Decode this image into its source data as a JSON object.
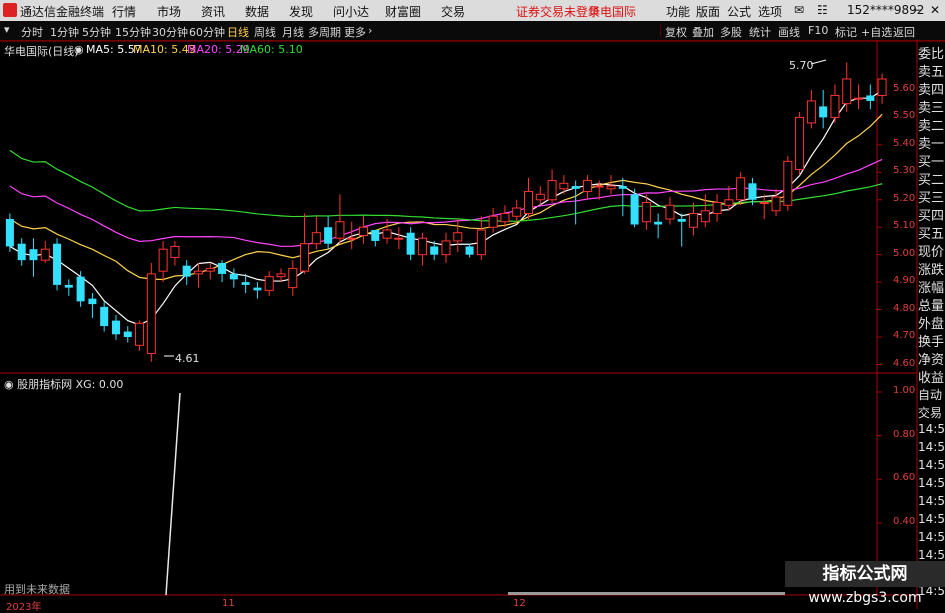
{
  "menubar": {
    "app_name": "通达信金融终端",
    "items": [
      "行情",
      "市场",
      "资讯",
      "数据",
      "发现",
      "问小达",
      "财富圈",
      "交易"
    ],
    "status": "证券交易未登录",
    "broker": "华电国际",
    "right_items": [
      "功能",
      "版面",
      "公式",
      "选项"
    ],
    "user": "152****9892"
  },
  "toolbar": {
    "periods": [
      "分时",
      "1分钟",
      "5分钟",
      "15分钟",
      "30分钟",
      "60分钟",
      "日线",
      "周线",
      "月线",
      "多周期",
      "更多"
    ],
    "active_period": "日线",
    "right_buttons": [
      "复权",
      "叠加",
      "多股",
      "统计",
      "画线",
      "F10",
      "标记",
      "+自选",
      "返回"
    ]
  },
  "main_chart": {
    "title": "华电国际(日线)",
    "ma_labels": [
      {
        "text": "MA5: 5.57",
        "color": "#ffffff"
      },
      {
        "text": "MA10: 5.43",
        "color": "#ffd24d"
      },
      {
        "text": "MA20: 5.29",
        "color": "#ff44ff"
      },
      {
        "text": "MA60: 5.10",
        "color": "#33dd33"
      }
    ],
    "high_label": "5.70",
    "low_label": "4.61"
  },
  "sub_chart": {
    "title": "股朋指标网",
    "xg_label": "XG: 0.00",
    "note": "用到未来数据"
  },
  "x_labels": [
    "2023年",
    "11",
    "12"
  ],
  "sidebar": [
    "委比",
    "卖五",
    "卖四",
    "卖三",
    "卖二",
    "卖一",
    "买一",
    "买二",
    "买三",
    "买四",
    "买五",
    "现价",
    "涨跌",
    "涨幅",
    "总量",
    "外盘",
    "换手",
    "净资",
    "收益"
  ],
  "sidebar2": [
    "自动",
    "交易",
    "14:56",
    "14:56",
    "14:56",
    "14:56",
    "14:56",
    "14:56",
    "14:56",
    "14:56",
    "14:56",
    "14:56"
  ],
  "watermark": {
    "line1": "指标公式网",
    "line2": "www.zbgs3.com"
  },
  "colors": {
    "up": "#ff3333",
    "down": "#33e0ff",
    "ma5": "#ffffff",
    "ma10": "#ffd24d",
    "ma20": "#ff44ff",
    "ma60": "#33dd33",
    "axis": "#aa0000"
  },
  "chart_data": {
    "type": "candlestick",
    "y_ticks": [
      "5.60",
      "5.50",
      "5.40",
      "5.30",
      "5.20",
      "5.10",
      "5.00",
      "4.90",
      "4.80",
      "4.70",
      "4.60"
    ],
    "sub_y_ticks": [
      "1.00",
      "0.80",
      "0.60",
      "0.40",
      "0.20"
    ],
    "ylim": [
      4.58,
      5.72
    ],
    "candles": [
      [
        5.13,
        5.03,
        5.15,
        5.01
      ],
      [
        5.04,
        4.98,
        5.06,
        4.96
      ],
      [
        5.02,
        4.98,
        5.06,
        4.92
      ],
      [
        4.98,
        5.02,
        5.05,
        4.97
      ],
      [
        5.04,
        4.89,
        5.06,
        4.87
      ],
      [
        4.89,
        4.88,
        4.91,
        4.85
      ],
      [
        4.92,
        4.83,
        4.94,
        4.81
      ],
      [
        4.84,
        4.82,
        4.86,
        4.77
      ],
      [
        4.81,
        4.74,
        4.83,
        4.72
      ],
      [
        4.76,
        4.71,
        4.78,
        4.69
      ],
      [
        4.72,
        4.7,
        4.74,
        4.68
      ],
      [
        4.67,
        4.75,
        4.76,
        4.65
      ],
      [
        4.64,
        4.93,
        4.97,
        4.61
      ],
      [
        4.94,
        5.02,
        5.05,
        4.9
      ],
      [
        4.99,
        5.03,
        5.05,
        4.96
      ],
      [
        4.96,
        4.92,
        4.98,
        4.89
      ],
      [
        4.93,
        4.94,
        4.97,
        4.88
      ],
      [
        4.94,
        4.95,
        4.97,
        4.91
      ],
      [
        4.97,
        4.93,
        4.98,
        4.9
      ],
      [
        4.93,
        4.91,
        4.95,
        4.88
      ],
      [
        4.9,
        4.89,
        4.93,
        4.86
      ],
      [
        4.88,
        4.87,
        4.9,
        4.84
      ],
      [
        4.87,
        4.92,
        4.94,
        4.85
      ],
      [
        4.92,
        4.93,
        4.95,
        4.9
      ],
      [
        4.88,
        4.95,
        4.98,
        4.85
      ],
      [
        4.94,
        5.04,
        5.15,
        4.93
      ],
      [
        5.04,
        5.08,
        5.14,
        5.02
      ],
      [
        5.1,
        5.04,
        5.14,
        5.02
      ],
      [
        5.06,
        5.12,
        5.22,
        5.04
      ],
      [
        5.06,
        5.06,
        5.12,
        5.02
      ],
      [
        5.07,
        5.1,
        5.14,
        5.04
      ],
      [
        5.09,
        5.05,
        5.08,
        5.03
      ],
      [
        5.06,
        5.09,
        5.13,
        5.04
      ],
      [
        5.06,
        5.06,
        5.1,
        5.02
      ],
      [
        5.08,
        5.0,
        5.1,
        4.98
      ],
      [
        5.0,
        5.06,
        5.08,
        4.96
      ],
      [
        5.03,
        5.0,
        5.05,
        4.98
      ],
      [
        5.0,
        5.05,
        5.08,
        4.97
      ],
      [
        5.05,
        5.08,
        5.13,
        5.01
      ],
      [
        5.03,
        5.0,
        5.04,
        4.99
      ],
      [
        5.0,
        5.09,
        5.14,
        4.98
      ],
      [
        5.1,
        5.14,
        5.17,
        5.08
      ],
      [
        5.12,
        5.15,
        5.18,
        5.1
      ],
      [
        5.14,
        5.17,
        5.2,
        5.12
      ],
      [
        5.15,
        5.23,
        5.28,
        5.13
      ],
      [
        5.2,
        5.22,
        5.25,
        5.18
      ],
      [
        5.2,
        5.27,
        5.31,
        5.19
      ],
      [
        5.24,
        5.26,
        5.29,
        5.22
      ],
      [
        5.25,
        5.24,
        5.27,
        5.11
      ],
      [
        5.23,
        5.27,
        5.29,
        5.2
      ],
      [
        5.25,
        5.25,
        5.27,
        5.2
      ],
      [
        5.24,
        5.25,
        5.29,
        5.22
      ],
      [
        5.25,
        5.24,
        5.28,
        5.14
      ],
      [
        5.22,
        5.11,
        5.24,
        5.1
      ],
      [
        5.12,
        5.19,
        5.22,
        5.09
      ],
      [
        5.12,
        5.11,
        5.15,
        5.06
      ],
      [
        5.13,
        5.18,
        5.21,
        5.11
      ],
      [
        5.13,
        5.12,
        5.15,
        5.03
      ],
      [
        5.1,
        5.15,
        5.19,
        5.07
      ],
      [
        5.12,
        5.16,
        5.22,
        5.1
      ],
      [
        5.15,
        5.19,
        5.22,
        5.12
      ],
      [
        5.18,
        5.2,
        5.25,
        5.16
      ],
      [
        5.2,
        5.28,
        5.3,
        5.18
      ],
      [
        5.26,
        5.2,
        5.28,
        5.18
      ],
      [
        5.19,
        5.19,
        5.22,
        5.13
      ],
      [
        5.16,
        5.21,
        5.24,
        5.14
      ],
      [
        5.18,
        5.34,
        5.36,
        5.16
      ],
      [
        5.31,
        5.5,
        5.52,
        5.29
      ],
      [
        5.48,
        5.56,
        5.6,
        5.46
      ],
      [
        5.54,
        5.5,
        5.6,
        5.46
      ],
      [
        5.5,
        5.58,
        5.62,
        5.48
      ],
      [
        5.55,
        5.64,
        5.7,
        5.52
      ],
      [
        5.57,
        5.57,
        5.62,
        5.53
      ],
      [
        5.58,
        5.56,
        5.62,
        5.53
      ],
      [
        5.58,
        5.64,
        5.66,
        5.55
      ]
    ]
  }
}
